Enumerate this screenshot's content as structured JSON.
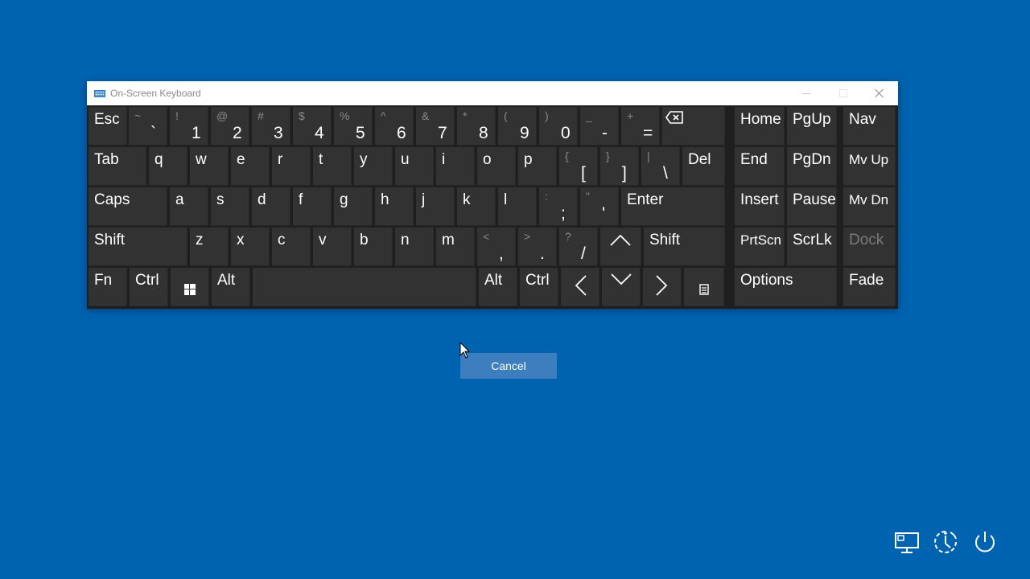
{
  "window": {
    "title": "On-Screen Keyboard",
    "icon": "keyboard-icon",
    "controls": [
      "minimize-icon",
      "maximize-icon",
      "close-icon"
    ]
  },
  "keys": [
    {
      "id": "esc",
      "label": "Esc"
    },
    {
      "id": "backtick",
      "top": "~",
      "main": "`"
    },
    {
      "id": "1",
      "top": "!",
      "main": "1"
    },
    {
      "id": "2",
      "top": "@",
      "main": "2"
    },
    {
      "id": "3",
      "top": "#",
      "main": "3"
    },
    {
      "id": "4",
      "top": "$",
      "main": "4"
    },
    {
      "id": "5",
      "top": "%",
      "main": "5"
    },
    {
      "id": "6",
      "top": "^",
      "main": "6"
    },
    {
      "id": "7",
      "top": "&",
      "main": "7"
    },
    {
      "id": "8",
      "top": "*",
      "main": "8"
    },
    {
      "id": "9",
      "top": "(",
      "main": "9"
    },
    {
      "id": "0",
      "top": ")",
      "main": "0"
    },
    {
      "id": "minus",
      "top": "_",
      "main": "-"
    },
    {
      "id": "equals",
      "top": "+",
      "main": "="
    },
    {
      "id": "backspace",
      "icon": "backspace-icon"
    },
    {
      "id": "home",
      "label": "Home"
    },
    {
      "id": "pgup",
      "label": "PgUp"
    },
    {
      "id": "nav",
      "label": "Nav"
    },
    {
      "id": "tab",
      "label": "Tab"
    },
    {
      "id": "q",
      "label": "q"
    },
    {
      "id": "w",
      "label": "w"
    },
    {
      "id": "e",
      "label": "e"
    },
    {
      "id": "r",
      "label": "r"
    },
    {
      "id": "t",
      "label": "t"
    },
    {
      "id": "y",
      "label": "y"
    },
    {
      "id": "u",
      "label": "u"
    },
    {
      "id": "i",
      "label": "i"
    },
    {
      "id": "o",
      "label": "o"
    },
    {
      "id": "p",
      "label": "p"
    },
    {
      "id": "lbracket",
      "top": "{",
      "main": "["
    },
    {
      "id": "rbracket",
      "top": "}",
      "main": "]"
    },
    {
      "id": "backslash",
      "top": "|",
      "main": "\\"
    },
    {
      "id": "del",
      "label": "Del"
    },
    {
      "id": "end",
      "label": "End"
    },
    {
      "id": "pgdn",
      "label": "PgDn"
    },
    {
      "id": "mvup",
      "label": "Mv Up"
    },
    {
      "id": "caps",
      "label": "Caps"
    },
    {
      "id": "a",
      "label": "a"
    },
    {
      "id": "s",
      "label": "s"
    },
    {
      "id": "d",
      "label": "d"
    },
    {
      "id": "f",
      "label": "f"
    },
    {
      "id": "g",
      "label": "g"
    },
    {
      "id": "h",
      "label": "h"
    },
    {
      "id": "j",
      "label": "j"
    },
    {
      "id": "k",
      "label": "k"
    },
    {
      "id": "l",
      "label": "l"
    },
    {
      "id": "semicolon",
      "top": ":",
      "main": ";"
    },
    {
      "id": "quote",
      "top": "\"",
      "main": "'"
    },
    {
      "id": "enter",
      "label": "Enter"
    },
    {
      "id": "insert",
      "label": "Insert"
    },
    {
      "id": "pause",
      "label": "Pause"
    },
    {
      "id": "mvdn",
      "label": "Mv Dn"
    },
    {
      "id": "lshift",
      "label": "Shift"
    },
    {
      "id": "z",
      "label": "z"
    },
    {
      "id": "x",
      "label": "x"
    },
    {
      "id": "c",
      "label": "c"
    },
    {
      "id": "v",
      "label": "v"
    },
    {
      "id": "b",
      "label": "b"
    },
    {
      "id": "n",
      "label": "n"
    },
    {
      "id": "m",
      "label": "m"
    },
    {
      "id": "comma",
      "top": "<",
      "main": ","
    },
    {
      "id": "period",
      "top": ">",
      "main": "."
    },
    {
      "id": "slash",
      "top": "?",
      "main": "/"
    },
    {
      "id": "up",
      "icon": "arrow-up-icon"
    },
    {
      "id": "rshift",
      "label": "Shift"
    },
    {
      "id": "prtscn",
      "label": "PrtScn"
    },
    {
      "id": "scrlk",
      "label": "ScrLk"
    },
    {
      "id": "dock",
      "label": "Dock"
    },
    {
      "id": "fn",
      "label": "Fn"
    },
    {
      "id": "lctrl",
      "label": "Ctrl"
    },
    {
      "id": "win",
      "icon": "windows-icon"
    },
    {
      "id": "lalt",
      "label": "Alt"
    },
    {
      "id": "space",
      "label": ""
    },
    {
      "id": "ralt",
      "label": "Alt"
    },
    {
      "id": "rctrl",
      "label": "Ctrl"
    },
    {
      "id": "left",
      "icon": "arrow-left-icon"
    },
    {
      "id": "down",
      "icon": "arrow-down-icon"
    },
    {
      "id": "right",
      "icon": "arrow-right-icon"
    },
    {
      "id": "menu",
      "icon": "context-menu-icon"
    },
    {
      "id": "options",
      "label": "Options"
    },
    {
      "id": "fade",
      "label": "Fade"
    }
  ],
  "cancel_button": {
    "label": "Cancel"
  },
  "system_icons": [
    "network-icon",
    "ease-of-access-icon",
    "power-icon"
  ],
  "colors": {
    "desktop_background": "#0063b0",
    "keyboard_background": "#1f1f1f",
    "key_background": "#323232",
    "cancel_button": "#3d7fbe",
    "disabled_text": "#7a7a7a"
  }
}
